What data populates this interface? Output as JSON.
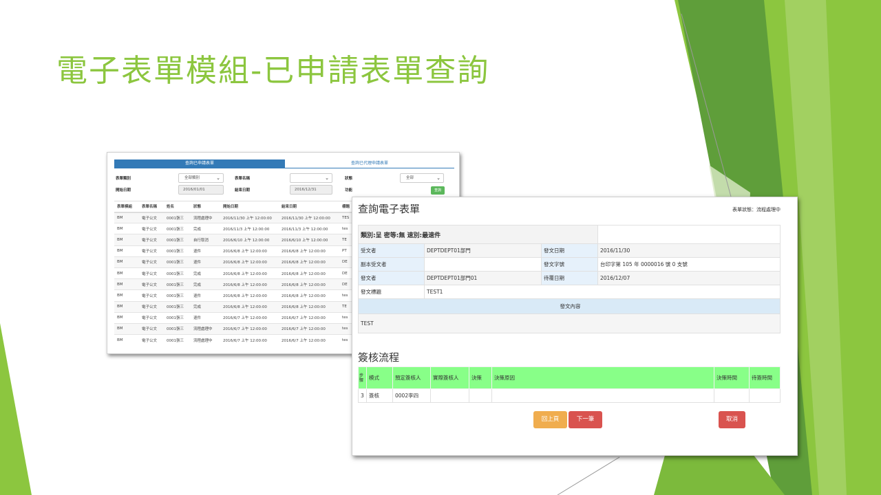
{
  "slide": {
    "title": "電子表單模組-已申請表單查詢"
  },
  "theme": {
    "accent": "#8cc63f",
    "primary": "#337ab7",
    "success": "#5cb85c",
    "warning": "#f0ad4e",
    "danger": "#d9534f",
    "flow_header": "#88ff88"
  },
  "query_window": {
    "tabs": [
      "查詢已申請表單",
      "查詢已代理申請表單"
    ],
    "filters": {
      "category_label": "表單類別",
      "category_value": "全部類別",
      "form_name_label": "表單名稱",
      "form_name_value": "",
      "status_label": "狀態",
      "status_value": "全部",
      "start_label": "開始日期",
      "start_value": "2016/01/01",
      "end_label": "結束日期",
      "end_value": "2016/12/31",
      "function_label": "功能",
      "search_button": "查詢"
    },
    "columns": [
      "表單模組",
      "表單名稱",
      "姓名",
      "狀態",
      "開始日期",
      "結束日期",
      "標題"
    ],
    "rows": [
      [
        "BM",
        "電子公文",
        "0001張三",
        "流程處理中",
        "2016/11/30 上午 12:00:00",
        "2016/11/30 上午 12:00:00",
        "TES"
      ],
      [
        "BM",
        "電子公文",
        "0001張三",
        "完成",
        "2016/11/3 上午 12:00:00",
        "2016/11/3 上午 12:00:00",
        "tes"
      ],
      [
        "BM",
        "電子公文",
        "0001張三",
        "自行取消",
        "2016/6/10 上午 12:00:00",
        "2016/6/10 上午 12:00:00",
        "TE"
      ],
      [
        "BM",
        "電子公文",
        "0001張三",
        "退件",
        "2016/6/8 上午 12:00:00",
        "2016/6/8 上午 12:00:00",
        "PT"
      ],
      [
        "BM",
        "電子公文",
        "0001張三",
        "退件",
        "2016/6/8 上午 12:00:00",
        "2016/6/8 上午 12:00:00",
        "DE"
      ],
      [
        "BM",
        "電子公文",
        "0001張三",
        "完成",
        "2016/6/8 上午 12:00:00",
        "2016/6/8 上午 12:00:00",
        "DE"
      ],
      [
        "BM",
        "電子公文",
        "0001張三",
        "完成",
        "2016/6/8 上午 12:00:00",
        "2016/6/8 上午 12:00:00",
        "DE"
      ],
      [
        "BM",
        "電子公文",
        "0001張三",
        "退件",
        "2016/6/8 上午 12:00:00",
        "2016/6/8 上午 12:00:00",
        "tes"
      ],
      [
        "BM",
        "電子公文",
        "0001張三",
        "完成",
        "2016/6/8 上午 12:00:00",
        "2016/6/8 上午 12:00:00",
        "TE"
      ],
      [
        "BM",
        "電子公文",
        "0001張三",
        "退件",
        "2016/6/7 上午 12:00:00",
        "2016/6/7 上午 12:00:00",
        "tes"
      ],
      [
        "BM",
        "電子公文",
        "0001張三",
        "流程處理中",
        "2016/6/7 上午 12:00:00",
        "2016/6/7 上午 12:00:00",
        "tes"
      ],
      [
        "BM",
        "電子公文",
        "0001張三",
        "流程處理中",
        "2016/6/7 上午 12:00:00",
        "2016/6/7 上午 12:00:00",
        "tes"
      ]
    ]
  },
  "detail_window": {
    "title": "查詢電子表單",
    "status": "表單狀態：流程處理中",
    "category_line": "類別:呈 密等:無 速別:最速件",
    "fields": {
      "recipient_label": "受文者",
      "recipient_value": "DEPTDEPT01部門",
      "send_date_label": "發文日期",
      "send_date_value": "2016/11/30",
      "cc_label": "副本受文者",
      "cc_value": "",
      "doc_no_label": "發文字號",
      "doc_no_value": "台印字第 105 年 0000016 號 0 支號",
      "sender_label": "發文者",
      "sender_value": "DEPTDEPT01部門01",
      "due_date_label": "待覆日期",
      "due_date_value": "2016/12/07",
      "subject_label": "發文標題",
      "subject_value": "TEST1",
      "content_header": "發文內容",
      "content_value": "TEST"
    },
    "flow_title": "簽核流程",
    "flow_columns": [
      "步驟",
      "模式",
      "預定簽核人",
      "實際簽核人",
      "決策",
      "決策原因",
      "決策時間",
      "待簽時間"
    ],
    "flow_rows": [
      [
        "3",
        "簽核",
        "0002李四",
        "",
        "",
        "",
        "",
        ""
      ]
    ],
    "buttons": {
      "prev": "回上頁",
      "next": "下一筆",
      "cancel": "取消"
    }
  }
}
